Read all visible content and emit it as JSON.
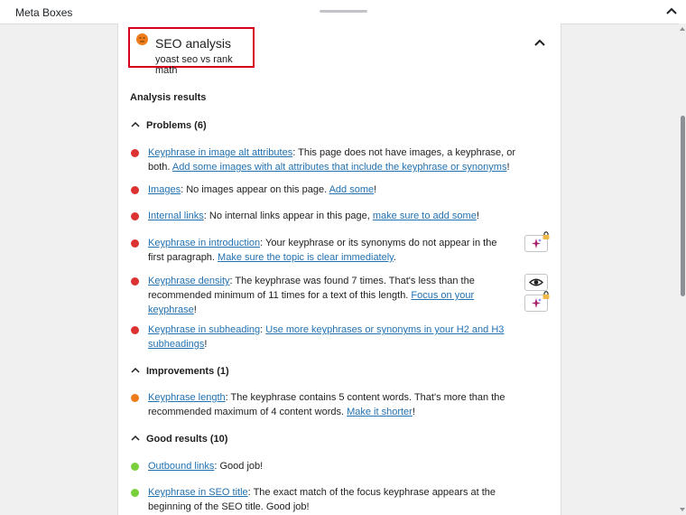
{
  "topbar": {
    "title": "Meta Boxes"
  },
  "seo_box": {
    "title": "SEO analysis",
    "subtitle": "yoast seo vs rank math"
  },
  "analysis_heading": "Analysis results",
  "colors": {
    "problem": "#dc3232",
    "improvement": "#ee7c1b",
    "good": "#7ad03a",
    "link": "#2271b1",
    "highlight_border": "#d6001c"
  },
  "groups": {
    "problems": {
      "label": "Problems (6)",
      "items": [
        {
          "link": "Keyphrase in image alt attributes",
          "text": ": This page does not have images, a keyphrase, or both. ",
          "action": "Add some images with alt attributes that include the keyphrase or synonyms",
          "tail": "!"
        },
        {
          "link": "Images",
          "text": ": No images appear on this page. ",
          "action": "Add some",
          "tail": "!"
        },
        {
          "link": "Internal links",
          "text": ": No internal links appear in this page, ",
          "action": "make sure to add some",
          "tail": "!"
        },
        {
          "link": "Keyphrase in introduction",
          "text": ": Your keyphrase or its synonyms do not appear in the first paragraph. ",
          "action": "Make sure the topic is clear immediately",
          "tail": "."
        },
        {
          "link": "Keyphrase density",
          "text": ": The keyphrase was found 7 times. That's less than the recommended minimum of 11 times for a text of this length. ",
          "action": "Focus on your keyphrase",
          "tail": "!"
        },
        {
          "link": "Keyphrase in subheading",
          "text": ": ",
          "action": "Use more keyphrases or synonyms in your H2 and H3 subheadings",
          "tail": "!"
        }
      ]
    },
    "improvements": {
      "label": "Improvements (1)",
      "items": [
        {
          "link": "Keyphrase length",
          "text": ": The keyphrase contains 5 content words. That's more than the recommended maximum of 4 content words. ",
          "action": "Make it shorter",
          "tail": "!"
        }
      ]
    },
    "good": {
      "label": "Good results (10)",
      "items": [
        {
          "link": "Outbound links",
          "text": ": Good job!"
        },
        {
          "link": "Keyphrase in SEO title",
          "text": ": The exact match of the focus keyphrase appears at the beginning of the SEO title. Good job!"
        }
      ]
    }
  }
}
